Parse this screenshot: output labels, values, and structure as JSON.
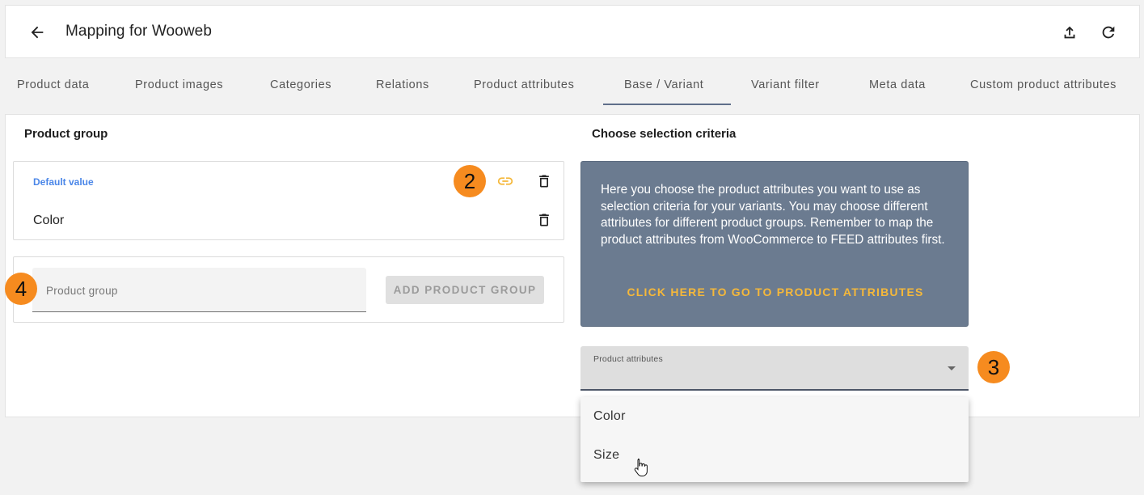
{
  "header": {
    "title": "Mapping for Wooweb",
    "back_icon": "arrow-left-icon",
    "upload_icon": "upload-icon",
    "refresh_icon": "refresh-icon"
  },
  "tabs": [
    {
      "label": "Product data",
      "active": false
    },
    {
      "label": "Product images",
      "active": false
    },
    {
      "label": "Categories",
      "active": false
    },
    {
      "label": "Relations",
      "active": false
    },
    {
      "label": "Product attributes",
      "active": false
    },
    {
      "label": "Base / Variant",
      "active": true
    },
    {
      "label": "Variant filter",
      "active": false
    },
    {
      "label": "Meta data",
      "active": false
    },
    {
      "label": "Custom product attributes",
      "active": false
    }
  ],
  "product_group": {
    "title": "Product group",
    "default_label": "Default value",
    "items": [
      "Color"
    ],
    "input_placeholder": "Product group",
    "add_button": "ADD PRODUCT GROUP"
  },
  "selection": {
    "title": "Choose selection criteria",
    "info_text": "Here you choose the product attributes you want to use as selection criteria for your variants. You may choose different attributes for different product groups. Remember to map the product attributes from WooCommerce to FEED attributes first.",
    "info_link": "CLICK HERE TO GO TO PRODUCT ATTRIBUTES",
    "select_label": "Product attributes",
    "options": [
      "Color",
      "Size"
    ]
  },
  "badges": {
    "link": "2",
    "select": "3",
    "input": "4"
  },
  "colors": {
    "accent_orange": "#f68b1f",
    "info_bg": "#6b7b90",
    "link_yellow": "#f5b83a",
    "default_blue": "#4a86e8",
    "tab_underline": "#5f6f8a"
  }
}
